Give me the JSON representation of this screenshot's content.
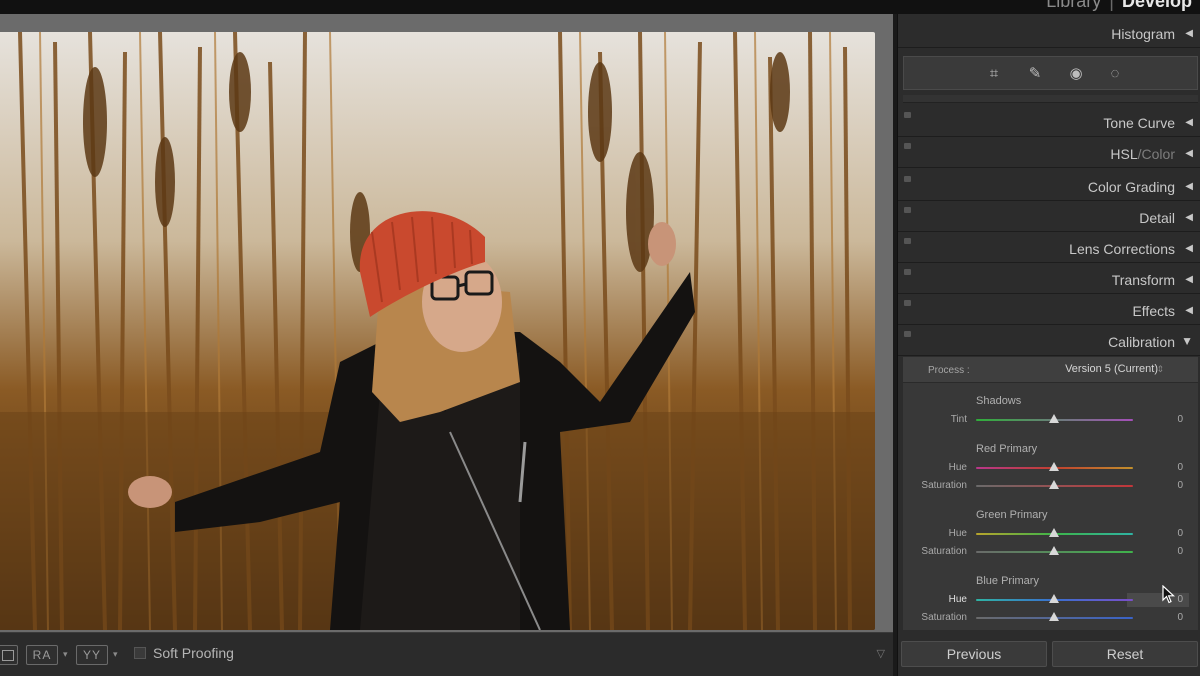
{
  "module_picker": {
    "library": "Library",
    "separator": "|",
    "develop": "Develop"
  },
  "panels": {
    "histogram": "Histogram",
    "tone_curve": "Tone Curve",
    "hsl": "HSL",
    "hsl_sep": "/",
    "color": "Color",
    "color_grading": "Color Grading",
    "detail": "Detail",
    "lens_corrections": "Lens Corrections",
    "transform": "Transform",
    "effects": "Effects",
    "calibration": "Calibration"
  },
  "tools": {
    "crop": "crop-icon",
    "heal": "healing-icon",
    "redeye": "red-eye-icon",
    "mask": "masking-icon"
  },
  "calibration": {
    "process_label": "Process :",
    "process_value": "Version 5 (Current)",
    "shadows": {
      "title": "Shadows",
      "tint_label": "Tint",
      "tint_value": "0"
    },
    "red": {
      "title": "Red Primary",
      "hue_label": "Hue",
      "hue_value": "0",
      "sat_label": "Saturation",
      "sat_value": "0"
    },
    "green": {
      "title": "Green Primary",
      "hue_label": "Hue",
      "hue_value": "0",
      "sat_label": "Saturation",
      "sat_value": "0"
    },
    "blue": {
      "title": "Blue Primary",
      "hue_label": "Hue",
      "hue_value": "0",
      "sat_label": "Saturation",
      "sat_value": "0"
    }
  },
  "toolbar": {
    "before_after": "RA",
    "before_after_split": "YY",
    "soft_proofing": "Soft Proofing"
  },
  "footer": {
    "previous": "Previous",
    "reset": "Reset"
  },
  "colors": {
    "panel_bg": "#2c2c2c",
    "canvas_bg": "#6b6b6b",
    "accent_text": "#c8c8c8"
  }
}
